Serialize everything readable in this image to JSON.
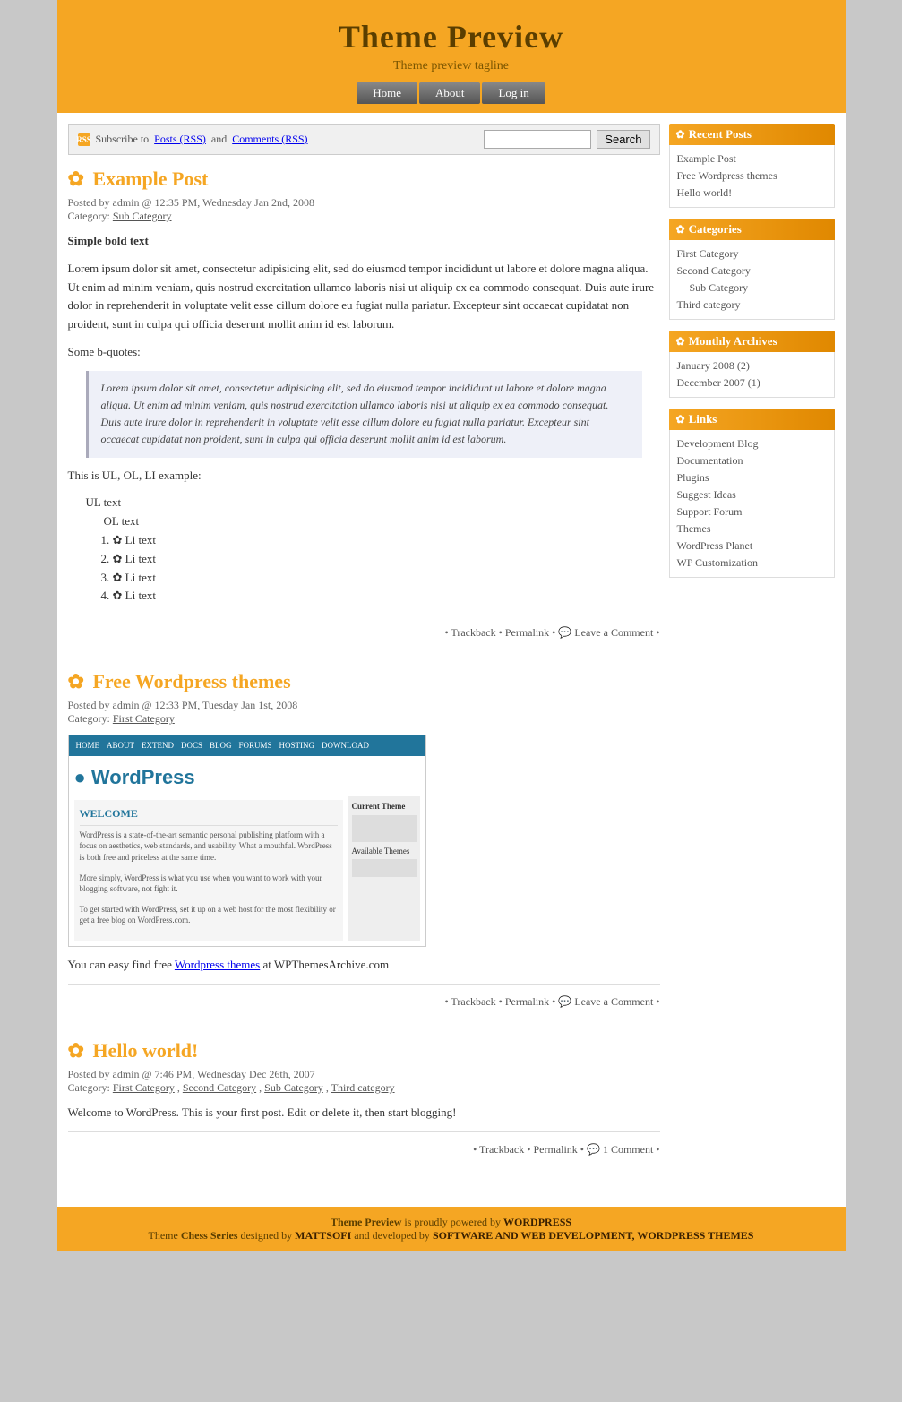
{
  "header": {
    "title": "Theme Preview",
    "tagline": "Theme preview tagline",
    "nav": [
      {
        "label": "Home",
        "href": "#"
      },
      {
        "label": "About",
        "href": "#"
      },
      {
        "label": "Log in",
        "href": "#"
      }
    ]
  },
  "search_bar": {
    "rss_text": "Subscribe to",
    "posts_rss": "Posts (RSS)",
    "and_text": "and",
    "comments_rss": "Comments (RSS)",
    "button_label": "Search",
    "placeholder": ""
  },
  "sidebar": {
    "recent_posts_title": "Recent Posts",
    "recent_posts": [
      {
        "label": "Example Post",
        "href": "#"
      },
      {
        "label": "Free Wordpress themes",
        "href": "#"
      },
      {
        "label": "Hello world!",
        "href": "#"
      }
    ],
    "categories_title": "Categories",
    "categories": [
      {
        "label": "First Category",
        "href": "#",
        "sub": false
      },
      {
        "label": "Second Category",
        "href": "#",
        "sub": false
      },
      {
        "label": "Sub Category",
        "href": "#",
        "sub": true
      },
      {
        "label": "Third category",
        "href": "#",
        "sub": false
      }
    ],
    "archives_title": "Monthly Archives",
    "archives": [
      {
        "label": "January 2008 (2)",
        "href": "#"
      },
      {
        "label": "December 2007 (1)",
        "href": "#"
      }
    ],
    "links_title": "Links",
    "links": [
      {
        "label": "Development Blog",
        "href": "#"
      },
      {
        "label": "Documentation",
        "href": "#"
      },
      {
        "label": "Plugins",
        "href": "#"
      },
      {
        "label": "Suggest Ideas",
        "href": "#"
      },
      {
        "label": "Support Forum",
        "href": "#"
      },
      {
        "label": "Themes",
        "href": "#"
      },
      {
        "label": "WordPress Planet",
        "href": "#"
      },
      {
        "label": "WP Customization",
        "href": "#"
      }
    ]
  },
  "posts": [
    {
      "id": "example-post",
      "title": "Example Post",
      "meta": "Posted by admin @ 12:35 PM, Wednesday Jan 2nd, 2008",
      "category_label": "Category:",
      "category": "Sub Category",
      "bold_text": "Simple bold text",
      "lorem": "Lorem ipsum dolor sit amet, consectetur adipisicing elit, sed do eiusmod tempor incididunt ut labore et dolore magna aliqua. Ut enim ad minim veniam, quis nostrud exercitation ullamco laboris nisi ut aliquip ex ea commodo consequat. Duis aute irure dolor in reprehenderit in voluptate velit esse cillum dolore eu fugiat nulla pariatur. Excepteur sint occaecat cupidatat non proident, sunt in culpa qui officia deserunt mollit anim id est laborum.",
      "bquote_label": "Some b-quotes:",
      "blockquote": "Lorem ipsum dolor sit amet, consectetur adipisicing elit, sed do eiusmod tempor incididunt ut labore et dolore magna aliqua. Ut enim ad minim veniam, quis nostrud exercitation ullamco laboris nisi ut aliquip ex ea commodo consequat. Duis aute irure dolor in reprehenderit in voluptate velit esse cillum dolore eu fugiat nulla pariatur. Excepteur sint occaecat cupidatat non proident, sunt in culpa qui officia deserunt mollit anim id est laborum.",
      "ul_label": "This is UL, OL, LI example:",
      "ul_item": "UL text",
      "ol_item": "OL text",
      "li_items": [
        "Li text",
        "Li text",
        "Li text",
        "Li text"
      ],
      "footer": {
        "trackback": "Trackback",
        "permalink": "Permalink",
        "comment": "Leave a Comment"
      }
    },
    {
      "id": "free-wordpress-themes",
      "title": "Free Wordpress themes",
      "meta": "Posted by admin @ 12:33 PM, Tuesday Jan 1st, 2008",
      "category_label": "Category:",
      "category": "First Category",
      "description": "You can easy find free",
      "link_text": "Wordpress themes",
      "description2": " at WPThemesArchive.com",
      "footer": {
        "trackback": "Trackback",
        "permalink": "Permalink",
        "comment": "Leave a Comment"
      }
    },
    {
      "id": "hello-world",
      "title": "Hello world!",
      "meta": "Posted by admin @ 7:46 PM, Wednesday Dec 26th, 2007",
      "category_label": "Category:",
      "categories": [
        "First Category",
        "Second Category",
        "Sub Category",
        "Third category"
      ],
      "content": "Welcome to WordPress. This is your first post. Edit or delete it, then start blogging!",
      "footer": {
        "trackback": "Trackback",
        "permalink": "Permalink",
        "comment": "1 Comment"
      }
    }
  ],
  "footer": {
    "text1": "Theme Preview",
    "text2": " is proudly powered by ",
    "wp": "WORDPRESS",
    "text3": "Theme ",
    "chess": "Chess Series",
    "text4": " designed by ",
    "mattsofi": "MATTSOFI",
    "text5": " and developed by ",
    "swbd": "SOFTWARE AND WEB DEVELOPMENT, WORDPRESS THEMES"
  }
}
